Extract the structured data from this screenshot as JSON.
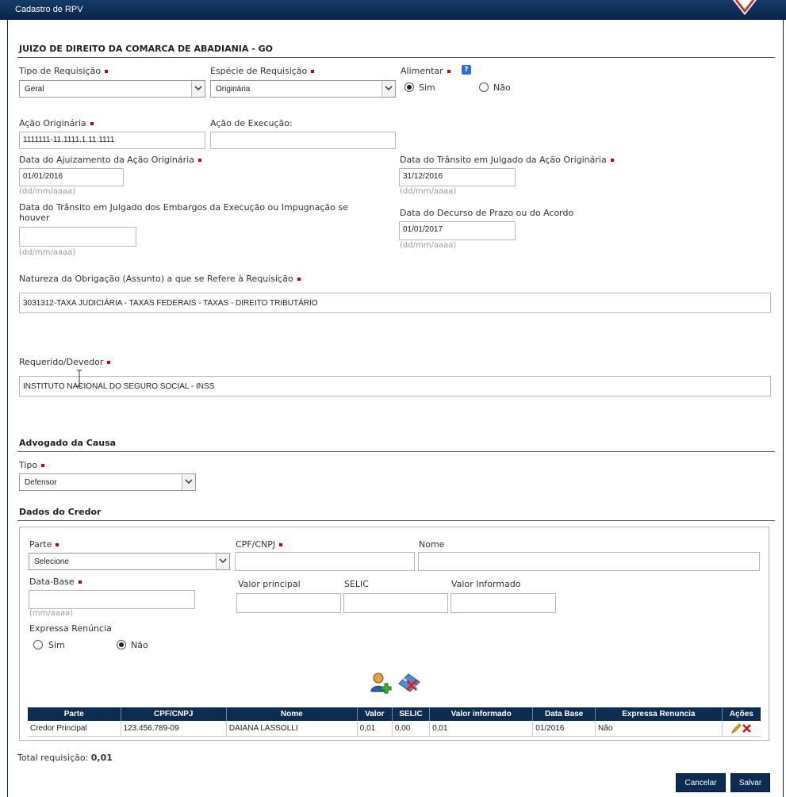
{
  "window": {
    "title": "Cadastro de RPV"
  },
  "court": "JUIZO DE DIREITO DA COMARCA DE ABADIANIA - GO",
  "fields": {
    "tipo_requisicao": {
      "label": "Tipo de Requisição",
      "value": "Geral"
    },
    "especie_requisicao": {
      "label": "Espécie de Requisição",
      "value": "Originária"
    },
    "alimentar": {
      "label": "Alimentar",
      "options": [
        "Sim",
        "Não"
      ],
      "selected": "Sim"
    },
    "acao_originaria": {
      "label": "Ação Originária",
      "value": "1111111-11.1111.1.11.1111"
    },
    "acao_execucao": {
      "label": "Ação de Execução:",
      "value": ""
    },
    "data_ajuizamento": {
      "label": "Data do Ajuizamento da Ação Originária",
      "value": "01/01/2016",
      "hint": "(dd/mm/aaaa)"
    },
    "data_transito_originaria": {
      "label": "Data do Trânsito em Julgado da Ação Originária",
      "value": "31/12/2016",
      "hint": "(dd/mm/aaaa)"
    },
    "data_transito_embargos": {
      "label_line1": "Data do Trânsito em Julgado dos Embargos da Execução ou Impugnação se",
      "label_line2": "houver",
      "value": "",
      "hint": "(dd/mm/aaaa)"
    },
    "data_decurso": {
      "label": "Data do Decurso de Prazo ou do Acordo",
      "value": "01/01/2017",
      "hint": "(dd/mm/aaaa)"
    },
    "natureza": {
      "label": "Natureza da Obrigação (Assunto) a que se Refere à Requisição",
      "value": "3031312-TAXA JUDICIÁRIA - TAXAS FEDERAIS - TAXAS  - DIREITO TRIBUTÁRIO"
    },
    "requerido": {
      "label": "Requerido/Devedor",
      "value": "INSTITUTO NACIONAL DO SEGURO SOCIAL - INSS"
    }
  },
  "advogado": {
    "section": "Advogado da Causa",
    "tipo_label": "Tipo",
    "tipo_value": "Defensor"
  },
  "credor": {
    "section": "Dados do Credor",
    "parte_label": "Parte",
    "parte_value": "Selecione",
    "cpf_label": "CPF/CNPJ",
    "nome_label": "Nome",
    "data_base_label": "Data-Base",
    "data_base_hint": "(mm/aaaa)",
    "valor_principal_label": "Valor principal",
    "selic_label": "SELIC",
    "valor_informado_label": "Valor Informado",
    "renuncia_label": "Expressa Renúncia",
    "renuncia_options": [
      "Sim",
      "Não"
    ],
    "renuncia_selected": "Não"
  },
  "table": {
    "headers": [
      "Parte",
      "CPF/CNPJ",
      "Nome",
      "Valor",
      "SELIC",
      "Valor informado",
      "Data Base",
      "Expressa Renuncia",
      "Ações"
    ],
    "rows": [
      [
        "Credor Principal",
        "123.456.789-09",
        "DAIANA LASSOLLI",
        "0,01",
        "0,00",
        "0,01",
        "01/2016",
        "Não"
      ]
    ]
  },
  "total": {
    "label": "Total requisição:",
    "value": "0,01"
  },
  "buttons": {
    "cancel": "Cancelar",
    "save": "Salvar"
  },
  "colors": {
    "header_bg": "#0d2c52",
    "required": "#cc0000",
    "hint": "#999999"
  },
  "icons": [
    "help-icon",
    "add-user-icon",
    "clear-eraser-icon",
    "edit-pencil-icon",
    "delete-x-icon"
  ]
}
